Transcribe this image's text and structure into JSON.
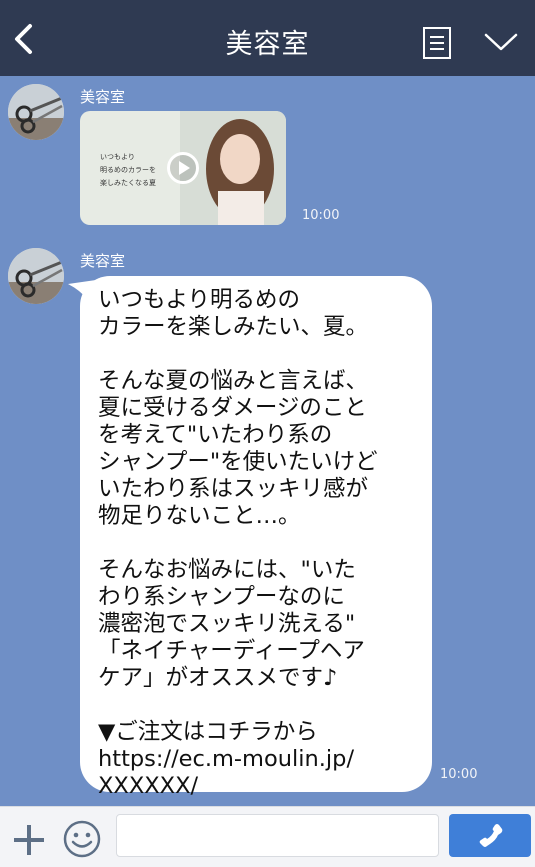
{
  "header": {
    "title": "美容室",
    "back_icon": "chevron-left-icon",
    "menu_icon": "document-list-icon",
    "dropdown_icon": "chevron-down-icon"
  },
  "messages": [
    {
      "sender": "美容室",
      "type": "video",
      "thumbnail_text": [
        "いつもより",
        "明るめのカラーを",
        "楽しみたくなる夏"
      ],
      "time": "10:00"
    },
    {
      "sender": "美容室",
      "type": "text",
      "text": "いつもより明るめの\nカラーを楽しみたい、夏。\n\nそんな夏の悩みと言えば、\n夏に受けるダメージのこと\nを考えて\"いたわり系の\nシャンプー\"を使いたいけど\nいたわり系はスッキリ感が\n物足りないこと…。\n\nそんなお悩みには、\"いた\nわり系シャンプーなのに\n濃密泡でスッキリ洗える\"\n「ネイチャーディープヘア\nケア」がオススメです♪\n\n▼ご注文はコチラから\nhttps://ec.m-moulin.jp/\nXXXXXX/",
      "time": "10:00"
    }
  ],
  "footer": {
    "plus_icon": "plus-icon",
    "emoji_icon": "smiley-icon",
    "input_value": "",
    "input_placeholder": "",
    "call_icon": "phone-icon"
  },
  "colors": {
    "background": "#6f8fc6",
    "header": "#2f3a52",
    "call_button": "#3f7fd8"
  }
}
